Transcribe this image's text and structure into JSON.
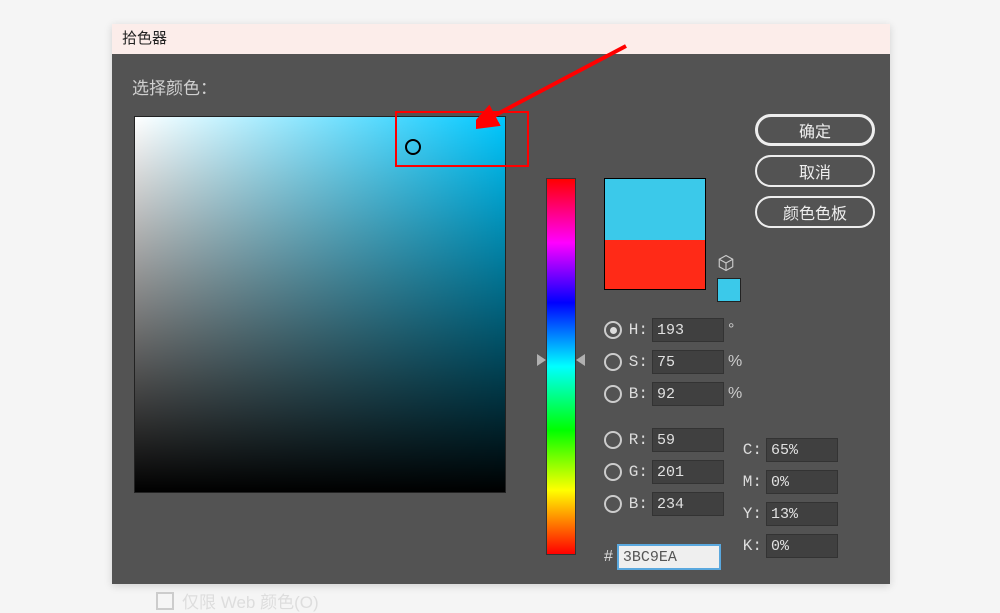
{
  "title": "拾色器",
  "select_label": "选择颜色：",
  "buttons": {
    "ok": "确定",
    "cancel": "取消",
    "swatches": "颜色色板"
  },
  "preview": {
    "new_color": "#3BC9EA",
    "old_color": "#ff2a17"
  },
  "hsb": {
    "h_label": "H:",
    "h_value": "193",
    "h_unit": "°",
    "s_label": "S:",
    "s_value": "75",
    "s_unit": "%",
    "b_label": "B:",
    "b_value": "92",
    "b_unit": "%"
  },
  "rgb": {
    "r_label": "R:",
    "r_value": "59",
    "g_label": "G:",
    "g_value": "201",
    "b_label": "B:",
    "b_value": "234"
  },
  "cmyk": {
    "c_label": "C:",
    "c_value": "65%",
    "m_label": "M:",
    "m_value": "0%",
    "y_label": "Y:",
    "y_value": "13%",
    "k_label": "K:",
    "k_value": "0%"
  },
  "hex": {
    "hash": "#",
    "value": "3BC9EA"
  },
  "web_only": "仅限 Web 颜色(O)",
  "libraries_icon": "⬚"
}
